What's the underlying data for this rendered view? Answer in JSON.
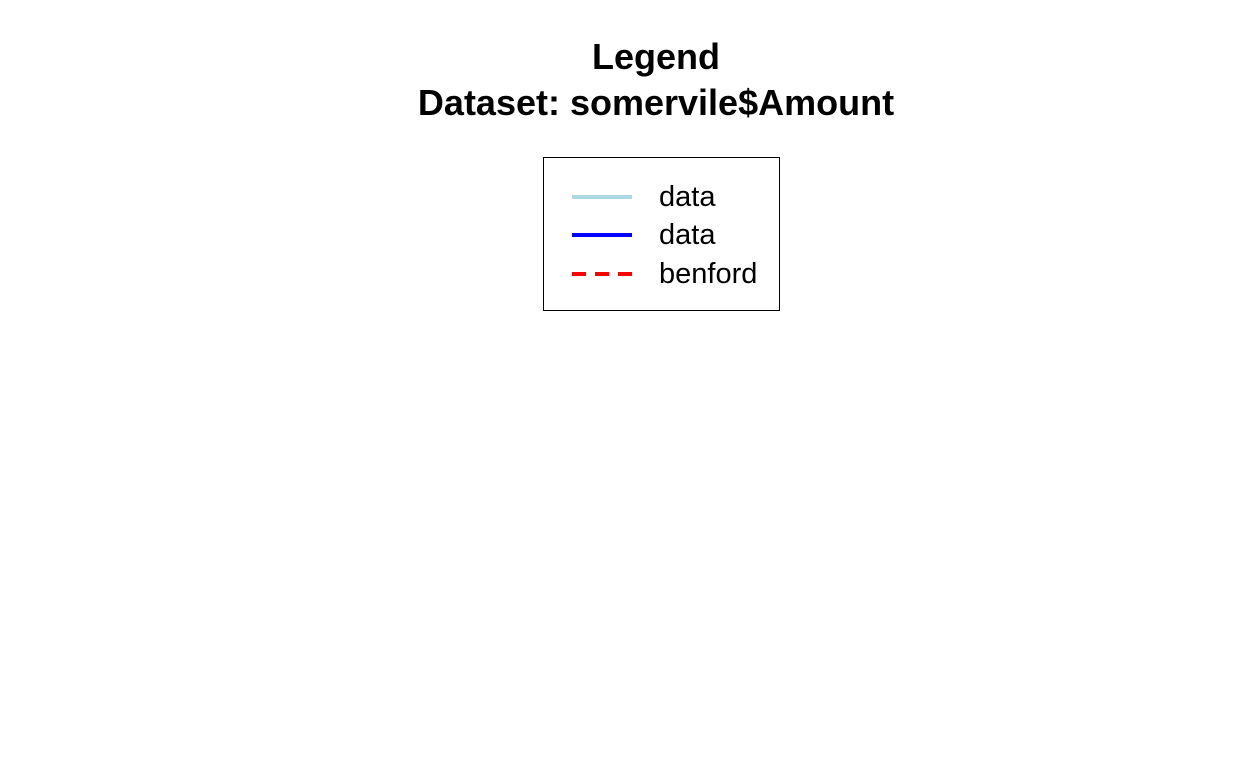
{
  "chart_data": {
    "type": "legend",
    "title": [
      "Legend",
      "Dataset: somervile$Amount"
    ],
    "legend_placement": "top-center",
    "legend": [
      {
        "label": "data",
        "color": "#add8e6",
        "line_style": "solid"
      },
      {
        "label": "data",
        "color": "#0000ff",
        "line_style": "solid"
      },
      {
        "label": "benford",
        "color": "#ff0000",
        "line_style": "dashed"
      }
    ]
  }
}
